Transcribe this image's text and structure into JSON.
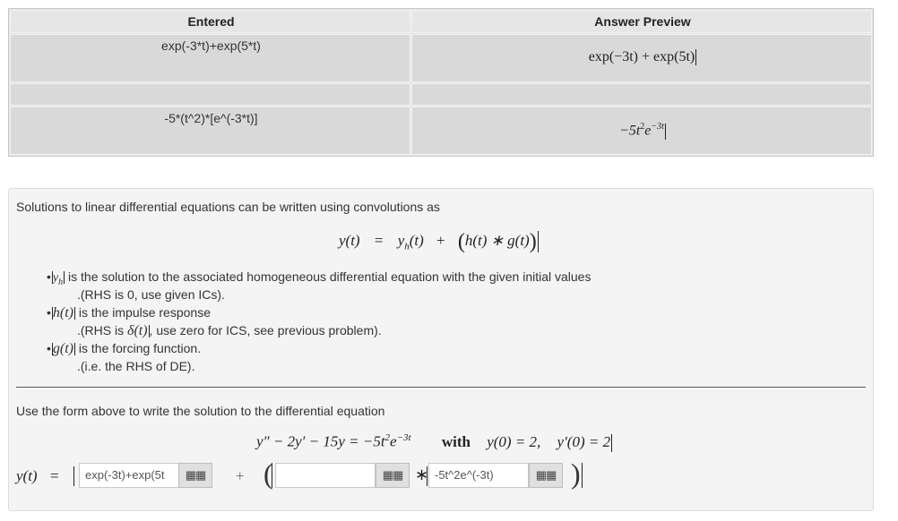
{
  "table": {
    "headers": [
      "Entered",
      "Answer Preview"
    ],
    "rows": [
      {
        "entered": "exp(-3*t)+exp(5*t)",
        "preview": "exp(−3t) + exp(5t)"
      },
      {
        "entered": "",
        "preview": ""
      },
      {
        "entered": "-5*(t^2)*[e^(-3*t)]",
        "preview_base": "−5t",
        "preview_exp1": "2",
        "preview_mid": "e",
        "preview_exp2": "−3t"
      }
    ]
  },
  "problem": {
    "intro": "Solutions to linear differential equations can be written using convolutions as",
    "conv_eq": {
      "lhs": "y(t)",
      "eq": "=",
      "yh": "y",
      "yh_sub": "h",
      "yh_arg": "(t)",
      "plus": "+",
      "conv": "h(t) ∗ g(t)"
    },
    "bullets": [
      {
        "sym": "y",
        "sub": "h",
        "text": "is the solution to the associated homogeneous differential equation with the given initial values",
        "sub_text": ".(RHS is 0, use given ICs)."
      },
      {
        "sym": "h(t)",
        "text": "is the impulse response",
        "sub_text_pre": ".(RHS is ",
        "delta": "δ(t)",
        "sub_text_post": ", use zero for ICS, see previous problem)."
      },
      {
        "sym": "g(t)",
        "text": "is the forcing function.",
        "sub_text": ".(i.e. the RHS of DE)."
      }
    ],
    "instruction": "Use the form above to write the solution to the differential equation",
    "de": {
      "lhs": "y″ − 2y′ − 15y = −5t",
      "exp1": "2",
      "e": "e",
      "exp2": "−3t",
      "with": "with",
      "ic1": "y(0) = 2,",
      "ic2": "y′(0) = 2"
    },
    "answer": {
      "lhs": "y(t)",
      "eq": "=",
      "plus": "+",
      "star": "∗",
      "yh_value": "exp(-3t)+exp(5t",
      "h_value": "",
      "g_value": "-5t^2e^(-3t)"
    }
  },
  "icons": {
    "grid": "grid-icon"
  }
}
